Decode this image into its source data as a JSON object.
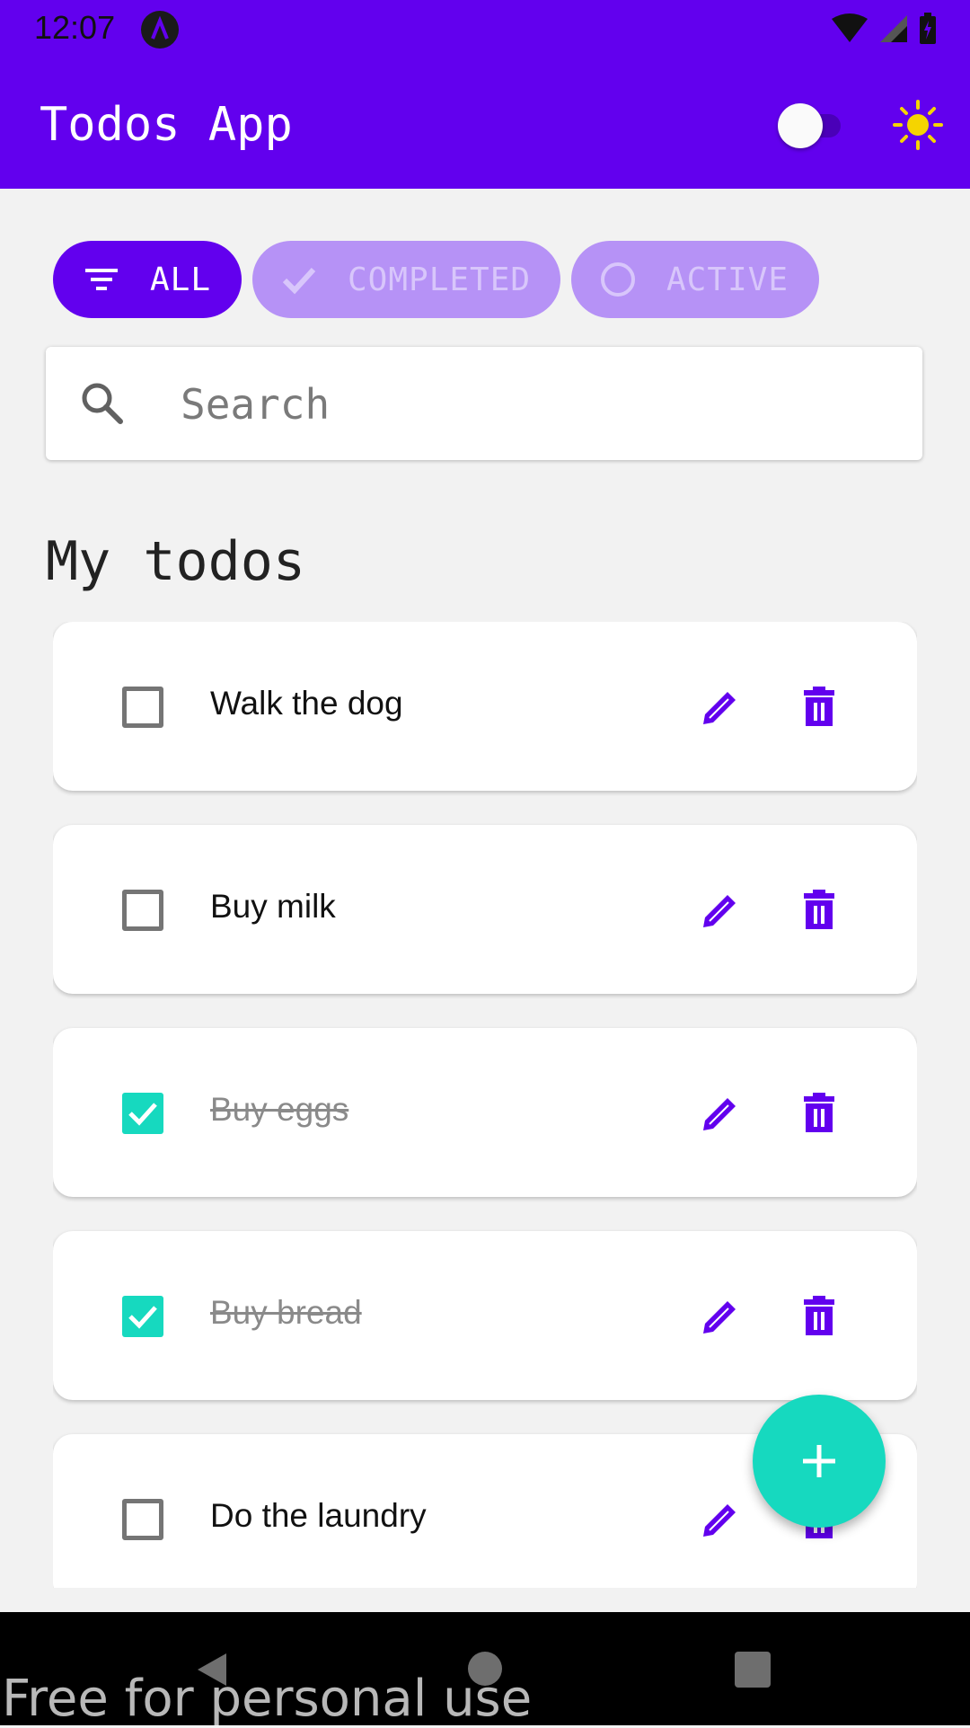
{
  "status_bar": {
    "time": "12:07"
  },
  "app_bar": {
    "title": "Todos App",
    "theme_toggle_on": false
  },
  "filters": [
    {
      "label": "ALL",
      "icon": "filter-icon",
      "selected": true
    },
    {
      "label": "COMPLETED",
      "icon": "check-icon",
      "selected": false
    },
    {
      "label": "ACTIVE",
      "icon": "circle-icon",
      "selected": false
    }
  ],
  "search": {
    "placeholder": "Search",
    "value": ""
  },
  "section_title": "My todos",
  "todos": [
    {
      "label": "Walk the dog",
      "done": false
    },
    {
      "label": "Buy milk",
      "done": false
    },
    {
      "label": "Buy eggs",
      "done": true
    },
    {
      "label": "Buy bread",
      "done": true
    },
    {
      "label": "Do the laundry",
      "done": false
    }
  ],
  "watermark": "Free for personal use",
  "colors": {
    "primary": "#6200ee",
    "chip_inactive": "#b692f6",
    "accent": "#16d9bf",
    "sun": "#f5d400"
  }
}
